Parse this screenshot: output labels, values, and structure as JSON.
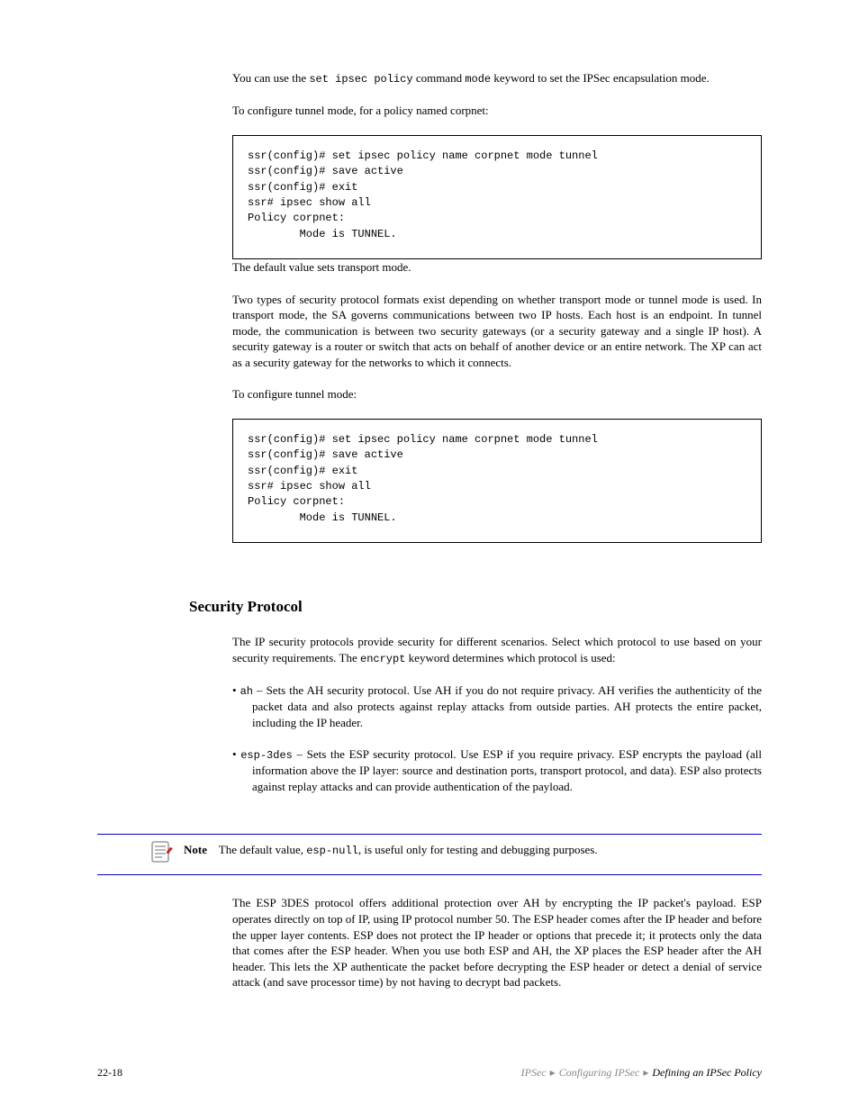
{
  "intro_para_1a": "You can use the ",
  "intro_para_1_cmd1": "set ipsec policy",
  "intro_para_1b": " command ",
  "intro_para_1_cmd2": "mode",
  "intro_para_1c": " keyword to set the IPSec encapsulation mode.",
  "intro_para_2": "To configure tunnel mode, for a policy named corpnet:",
  "code1_line1": "ssr(config)# set ipsec policy name corpnet mode tunnel",
  "code1_line2": "ssr(config)# save active",
  "code1_line3": "ssr(config)# exit",
  "code1_line4": "ssr# ipsec show all",
  "code1_line5": "Policy corpnet:",
  "code1_line6": "        Mode is TUNNEL.",
  "mid_para_1": "The default value sets transport mode.",
  "mid_para_2": "Two types of security protocol formats exist depending on whether transport mode or tunnel mode is used. In transport mode, the SA governs communications between two IP hosts. Each host is an endpoint. In tunnel mode, the communication is between two security gateways (or a security gateway and a single IP host). A security gateway is a router or switch that acts on behalf of another device or an entire network. The XP can act as a security gateway for the networks to which it connects.",
  "mid_para_3": "To configure tunnel mode:",
  "code2_line1": "ssr(config)# set ipsec policy name corpnet mode tunnel",
  "code2_line2": "ssr(config)# save active",
  "code2_line3": "ssr(config)# exit",
  "code2_line4": "ssr# ipsec show all",
  "code2_line5": "Policy corpnet:",
  "code2_line6": "        Mode is TUNNEL.",
  "subheading": "Security Protocol",
  "sp_para_a": "The IP security protocols provide security for different scenarios. Select which protocol to use based on your security requirements. The ",
  "sp_para_cmd": "encrypt",
  "sp_para_b": " keyword determines which protocol is used:",
  "sp_item1_lead": "• ",
  "sp_item1_key": "ah",
  "sp_item1_text": " – Sets the AH security protocol. Use AH if you do not require privacy. AH verifies the authenticity of the packet data and also protects against replay attacks from outside parties. AH protects the entire packet, including the IP header.",
  "sp_item2_lead": "• ",
  "sp_item2_key": "esp-3des",
  "sp_item2_text": " – Sets the ESP security protocol. Use ESP if you require privacy. ESP encrypts the payload (all information above the IP layer: source and destination ports, transport protocol, and data). ESP also protects against replay attacks and can provide authentication of the payload.",
  "note_label": "Note",
  "note_text_a": "The default value, ",
  "note_text_key": "esp-null",
  "note_text_b": ", is useful only for testing and debugging purposes.",
  "esp3des_para": "The ESP 3DES protocol offers additional protection over AH by encrypting the IP packet's payload. ESP operates directly on top of IP, using IP protocol number 50. The ESP header comes after the IP header and before the upper layer contents. ESP does not protect the IP header or options that precede it; it protects only the data that comes after the ESP header. When you use both ESP and AH, the XP places the ESP header after the AH header. This lets the XP authenticate the packet before decrypting the ESP header or detect a denial of service attack (and save processor time) by not having to decrypt bad packets.",
  "footer_page": "22-18",
  "footer_crumb1": "IPSec",
  "footer_crumb2": "Configuring IPSec",
  "footer_crumb3": "Defining an IPSec Policy"
}
